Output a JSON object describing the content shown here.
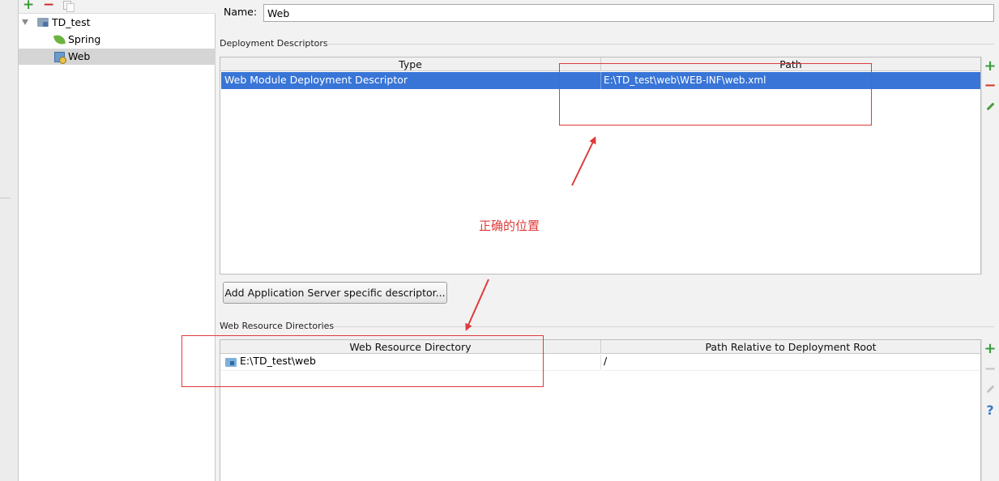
{
  "tree": {
    "toolbar": {
      "add_icon": "+",
      "remove_icon": "−"
    },
    "items": [
      {
        "label": "TD_test",
        "icon": "module-folder-icon",
        "expanded": true
      },
      {
        "label": "Spring",
        "icon": "spring-leaf-icon"
      },
      {
        "label": "Web",
        "icon": "web-facet-icon",
        "selected": true
      }
    ]
  },
  "name_field": {
    "label": "Name:",
    "value": "Web"
  },
  "deployment_descriptors": {
    "title": "Deployment Descriptors",
    "columns": [
      "Type",
      "Path"
    ],
    "rows": [
      {
        "type": "Web Module Deployment Descriptor",
        "path": "E:\\TD_test\\web\\WEB-INF\\web.xml",
        "selected": true
      }
    ]
  },
  "add_server_button": "Add Application Server specific descriptor...",
  "web_resource_directories": {
    "title": "Web Resource Directories",
    "columns": [
      "Web Resource Directory",
      "Path Relative to Deployment Root"
    ],
    "rows": [
      {
        "directory": "E:\\TD_test\\web",
        "relative_path": "/"
      }
    ]
  },
  "side_toolbar": {
    "add_icon": "+",
    "remove_icon": "−",
    "help_icon": "?"
  },
  "annotation": {
    "text": "正确的位置",
    "color": "#e03a3a"
  },
  "colors": {
    "selection": "#3875d7",
    "tree_selected": "#d5d5d5",
    "add_green": "#3a9c3a",
    "remove_red": "#cc2b2b"
  }
}
